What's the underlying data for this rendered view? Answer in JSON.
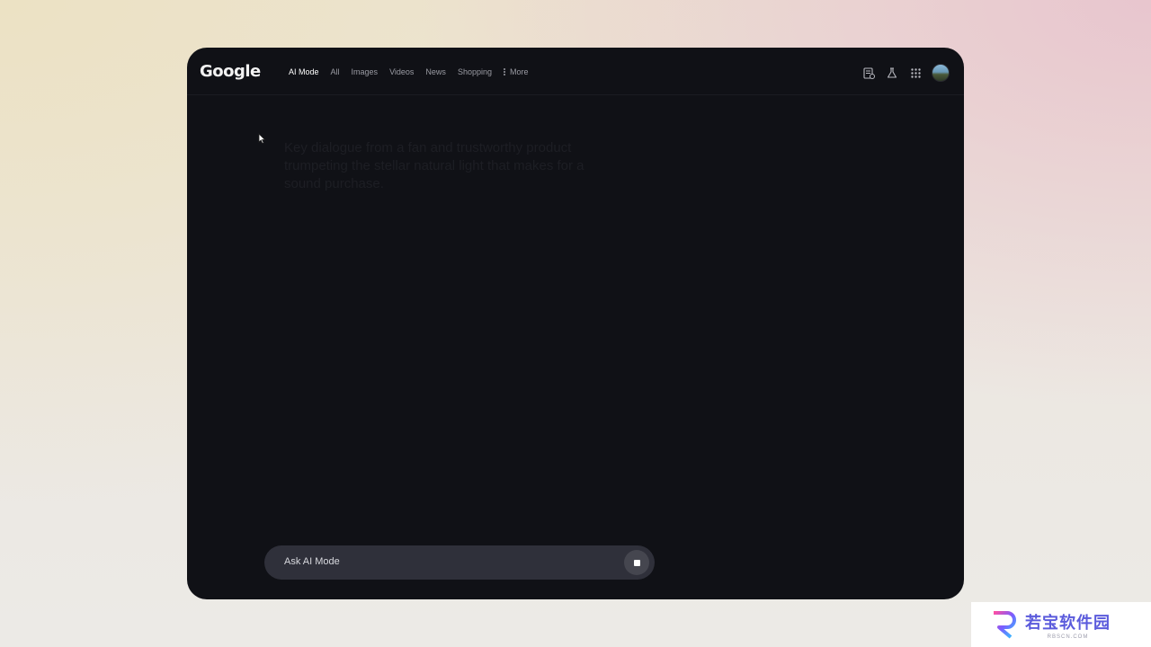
{
  "header": {
    "logo": "Google",
    "tabs": [
      {
        "label": "AI Mode",
        "active": true
      },
      {
        "label": "All"
      },
      {
        "label": "Images"
      },
      {
        "label": "Videos"
      },
      {
        "label": "News"
      },
      {
        "label": "Shopping"
      }
    ],
    "more_label": "More",
    "icons": [
      "history-icon",
      "labs-flask-icon",
      "apps-grid-icon",
      "profile-avatar"
    ]
  },
  "main": {
    "faded_text": "Key dialogue from a fan and trustworthy product trumpeting the stellar natural light that makes for a sound purchase."
  },
  "composer": {
    "placeholder": "Ask AI Mode",
    "action_icon": "stop-icon"
  },
  "watermark": {
    "title": "若宝软件园",
    "subtitle": "RBSCN.COM"
  },
  "colors": {
    "window_bg": "#101116",
    "composer_bg": "#2f303a",
    "active_tab": "#ffffff",
    "inactive_tab": "#9a9ba3"
  }
}
